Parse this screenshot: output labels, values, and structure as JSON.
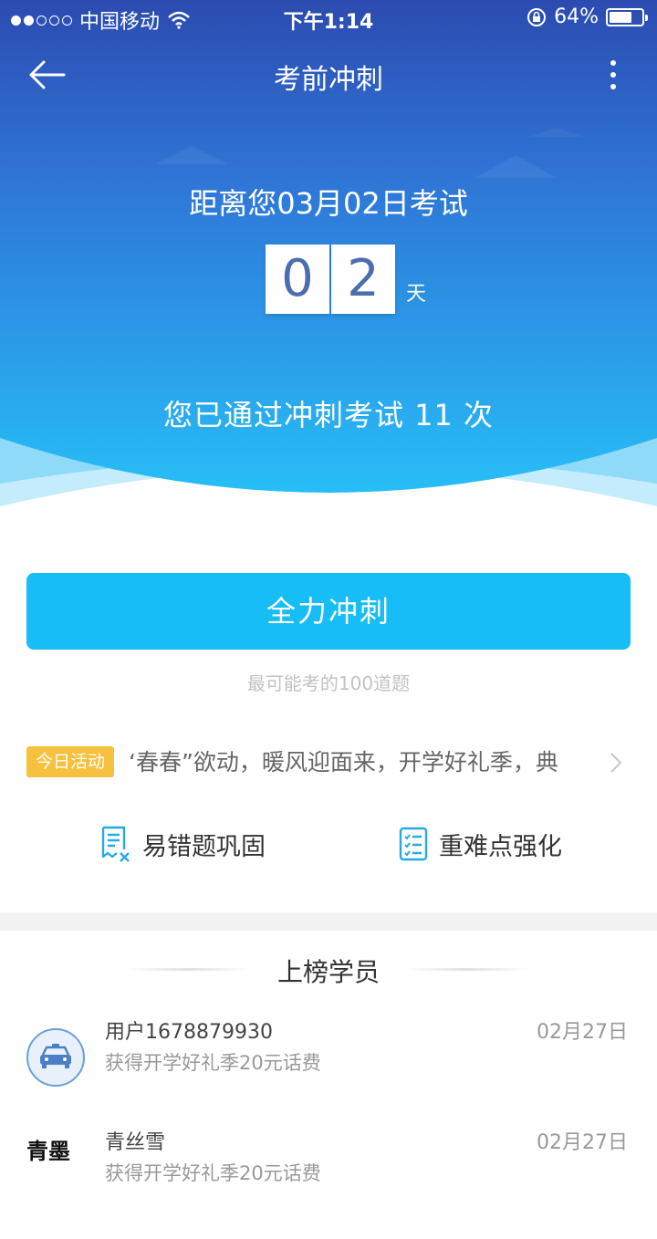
{
  "status_bar": {
    "carrier": "中国移动",
    "time": "下午1:14",
    "battery": "64%",
    "battery_level": 0.64
  },
  "nav": {
    "title": "考前冲刺"
  },
  "countdown": {
    "label": "距离您03月02日考试",
    "digits": [
      "0",
      "2"
    ],
    "unit": "天"
  },
  "passed_text": "您已通过冲刺考试 11 次",
  "sprint": {
    "button_label": "全力冲刺",
    "subtitle": "最可能考的100道题"
  },
  "activity": {
    "tag": "今日活动",
    "text": "‘春春”欲动，暖风迎面来，开学好礼季，典"
  },
  "quick_links": [
    {
      "label": "易错题巩固",
      "icon": "error-notes-icon"
    },
    {
      "label": "重难点强化",
      "icon": "checklist-icon"
    }
  ],
  "leaderboard": {
    "title": "上榜学员",
    "rows": [
      {
        "name": "用户1678879930",
        "desc": "获得开学好礼季20元话费",
        "date": "02月27日",
        "avatar": "car-avatar"
      },
      {
        "name": "青丝雪",
        "desc": "获得开学好礼季20元话费",
        "date": "02月27日",
        "avatar": "ink-avatar",
        "avatar_text": "青墨"
      }
    ]
  },
  "colors": {
    "hero_top": "#2c4fb3",
    "hero_bottom": "#27b8f5",
    "button": "#16bdf6",
    "tag": "#f7c140",
    "digit_text": "#4a6eb0"
  }
}
